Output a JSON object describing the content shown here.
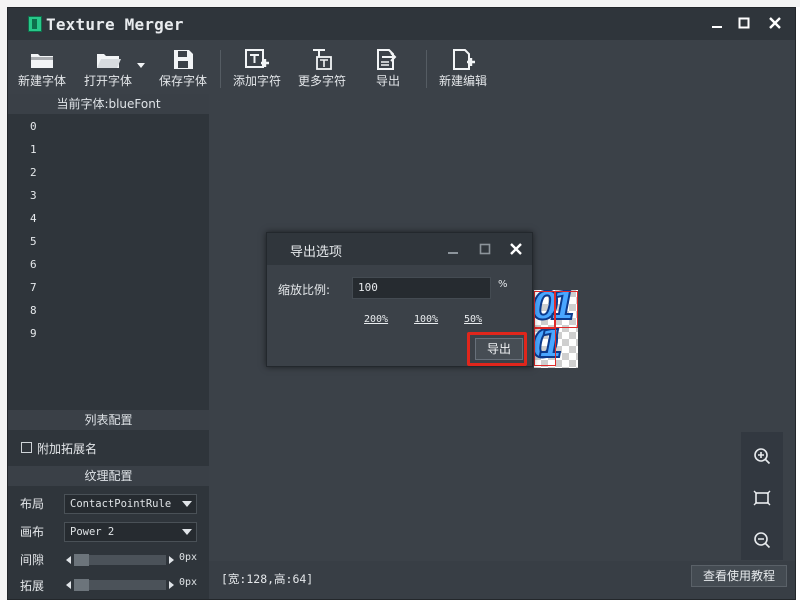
{
  "window": {
    "title": "Texture Merger"
  },
  "toolbar": {
    "new_font": "新建字体",
    "open_font": "打开字体",
    "save_font": "保存字体",
    "add_char": "添加字符",
    "more_chars": "更多字符",
    "export": "导出",
    "new_edit": "新建编辑"
  },
  "left_panel": {
    "current_font_label": "当前字体:blueFont",
    "chars": [
      "0",
      "1",
      "2",
      "3",
      "4",
      "5",
      "6",
      "7",
      "8",
      "9"
    ],
    "list_config": "列表配置",
    "append_ext_label": "附加拓展名",
    "append_ext_checked": false,
    "texture_config": "纹理配置",
    "layout_label": "布局",
    "layout_value": "ContactPointRule",
    "canvas_label": "画布",
    "canvas_value": "Power 2",
    "gap_label": "间隙",
    "gap_value": "0px",
    "gap_level": 0,
    "expand_label": "拓展",
    "expand_value": "0px",
    "expand_level": 0
  },
  "status": {
    "size_text": "[宽:128,高:64]"
  },
  "tutorial_button": "查看使用教程",
  "zoom": {
    "icons": [
      "zoom-in-icon",
      "fit-icon",
      "zoom-out-icon"
    ]
  },
  "dialog": {
    "title": "导出选项",
    "scale_label": "缩放比例:",
    "scale_value": "100",
    "unit": "%",
    "presets": [
      "200%",
      "100%",
      "50%"
    ],
    "export_button": "导出"
  },
  "preview": {
    "glyphs": [
      "0",
      "1",
      "0",
      "1"
    ]
  },
  "colors": {
    "highlight": "#e0261c",
    "app_bg": "#3b4148",
    "panel_bg": "#2f353b"
  }
}
